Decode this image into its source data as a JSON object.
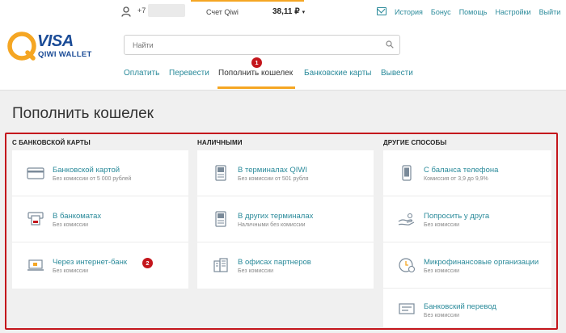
{
  "topbar": {
    "phone_prefix": "+7",
    "account_label": "Счет Qiwi",
    "balance": "38,11 ₽",
    "caret": "▾",
    "links": [
      "История",
      "Бонус",
      "Помощь",
      "Настройки",
      "Выйти"
    ]
  },
  "logo": {
    "visa": "VISA",
    "wallet": "QIWI WALLET"
  },
  "search": {
    "placeholder": "Найти"
  },
  "nav": {
    "items": [
      "Оплатить",
      "Перевести",
      "Пополнить кошелек",
      "Банковские карты",
      "Вывести"
    ],
    "active_index": 2,
    "badge": "1"
  },
  "page_title": "Пополнить кошелек",
  "columns": [
    {
      "header": "С БАНКОВСКОЙ КАРТЫ",
      "items": [
        {
          "title": "Банковской картой",
          "subtitle": "Без комиссии от 5 000 рублей",
          "icon": "credit-card-icon"
        },
        {
          "title": "В банкоматах",
          "subtitle": "Без комиссии",
          "icon": "atm-icon"
        },
        {
          "title": "Через интернет-банк",
          "subtitle": "Без комиссии",
          "icon": "laptop-icon",
          "badge": "2"
        }
      ]
    },
    {
      "header": "НАЛИЧНЫМИ",
      "items": [
        {
          "title": "В терминалах QIWI",
          "subtitle": "Без комиссии от 501 рубля",
          "icon": "terminal-icon"
        },
        {
          "title": "В других терминалах",
          "subtitle": "Наличными без комиссии",
          "icon": "terminal-icon"
        },
        {
          "title": "В офисах партнеров",
          "subtitle": "Без комиссии",
          "icon": "office-icon"
        }
      ]
    },
    {
      "header": "ДРУГИЕ СПОСОБЫ",
      "items": [
        {
          "title": "С баланса телефона",
          "subtitle": "Комиссия от 3,9 до 9,9%",
          "icon": "phone-icon"
        },
        {
          "title": "Попросить у друга",
          "subtitle": "Без комиссии",
          "icon": "hand-icon"
        },
        {
          "title": "Микрофинансовые организации",
          "subtitle": "Без комиссии",
          "icon": "coin-clock-icon"
        },
        {
          "title": "Банковский перевод",
          "subtitle": "Без комиссии",
          "icon": "bank-transfer-icon"
        }
      ]
    }
  ],
  "colors": {
    "accent": "#f5a623",
    "link": "#2a8a9a",
    "badge": "#c4161c",
    "frame": "#c4161c",
    "brand": "#1a4b96"
  }
}
